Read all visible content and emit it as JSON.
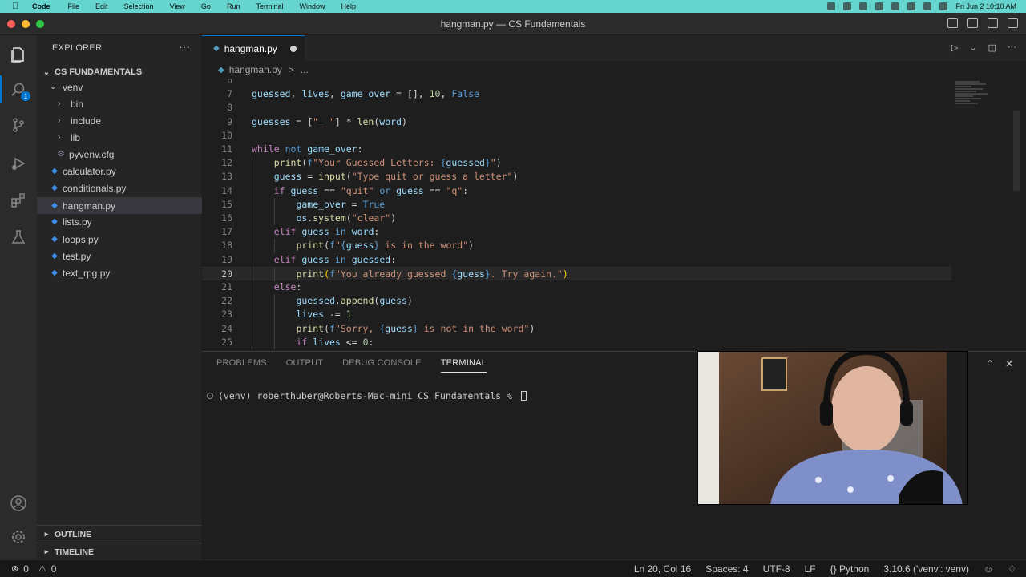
{
  "menubar": {
    "app": "Code",
    "items": [
      "File",
      "Edit",
      "Selection",
      "View",
      "Go",
      "Run",
      "Terminal",
      "Window",
      "Help"
    ],
    "datetime": "Fri Jun 2  10:10 AM"
  },
  "window": {
    "title": "hangman.py — CS Fundamentals"
  },
  "activity": {
    "explorer_badge": "1"
  },
  "sidebar": {
    "header": "EXPLORER",
    "more": "···",
    "folder": "CS FUNDAMENTALS",
    "items": [
      {
        "label": "venv",
        "type": "folder-open",
        "depth": 1
      },
      {
        "label": "bin",
        "type": "folder",
        "depth": 2
      },
      {
        "label": "include",
        "type": "folder",
        "depth": 2
      },
      {
        "label": "lib",
        "type": "folder",
        "depth": 2
      },
      {
        "label": "pyvenv.cfg",
        "type": "config",
        "depth": 2
      },
      {
        "label": "calculator.py",
        "type": "py",
        "depth": 1
      },
      {
        "label": "conditionals.py",
        "type": "py",
        "depth": 1
      },
      {
        "label": "hangman.py",
        "type": "py",
        "depth": 1,
        "selected": true
      },
      {
        "label": "lists.py",
        "type": "py",
        "depth": 1
      },
      {
        "label": "loops.py",
        "type": "py",
        "depth": 1
      },
      {
        "label": "test.py",
        "type": "py",
        "depth": 1
      },
      {
        "label": "text_rpg.py",
        "type": "py",
        "depth": 1
      }
    ],
    "outline": "OUTLINE",
    "timeline": "TIMELINE"
  },
  "editor": {
    "tab_label": "hangman.py",
    "breadcrumb_file": "hangman.py",
    "breadcrumb_more": "...",
    "current_line": 20,
    "lines": [
      {
        "num": "6",
        "indent": 0,
        "html": ""
      },
      {
        "num": "7",
        "indent": 0,
        "html": "<span class='va'>guessed</span>, <span class='va'>lives</span>, <span class='va'>game_over</span> = [], <span class='nu'>10</span>, <span class='bi'>False</span>"
      },
      {
        "num": "8",
        "indent": 0,
        "html": ""
      },
      {
        "num": "9",
        "indent": 0,
        "html": "<span class='va'>guesses</span> = [<span class='st'>\"_ \"</span>] * <span class='fn'>len</span>(<span class='va'>word</span>)"
      },
      {
        "num": "10",
        "indent": 0,
        "html": ""
      },
      {
        "num": "11",
        "indent": 0,
        "html": "<span class='kw'>while</span> <span class='bi'>not</span> <span class='va'>game_over</span>:"
      },
      {
        "num": "12",
        "indent": 1,
        "html": "<span class='fn'>print</span>(<span class='bi'>f</span><span class='st'>\"Your Guessed Letters: </span><span class='bi'>{</span><span class='va'>guessed</span><span class='bi'>}</span><span class='st'>\"</span>)"
      },
      {
        "num": "13",
        "indent": 1,
        "html": "<span class='va'>guess</span> = <span class='fn'>input</span>(<span class='st'>\"Type quit or guess a letter\"</span>)"
      },
      {
        "num": "14",
        "indent": 1,
        "html": "<span class='kw'>if</span> <span class='va'>guess</span> == <span class='st'>\"quit\"</span> <span class='bi'>or</span> <span class='va'>guess</span> == <span class='st'>\"q\"</span>:"
      },
      {
        "num": "15",
        "indent": 2,
        "html": "<span class='va'>game_over</span> = <span class='bi'>True</span>"
      },
      {
        "num": "16",
        "indent": 2,
        "html": "<span class='va'>os</span>.<span class='fn'>system</span>(<span class='st'>\"clear\"</span>)"
      },
      {
        "num": "17",
        "indent": 1,
        "html": "<span class='kw'>elif</span> <span class='va'>guess</span> <span class='bi'>in</span> <span class='va'>word</span>:"
      },
      {
        "num": "18",
        "indent": 2,
        "html": "<span class='fn'>print</span>(<span class='bi'>f</span><span class='st'>\"</span><span class='bi'>{</span><span class='va'>guess</span><span class='bi'>}</span><span class='st'> is in the word\"</span>)"
      },
      {
        "num": "19",
        "indent": 1,
        "html": "<span class='kw'>elif</span> <span class='va'>guess</span> <span class='bi'>in</span> <span class='va'>guessed</span>:"
      },
      {
        "num": "20",
        "indent": 2,
        "html": "<span class='fn'>print</span><span class='br'>(</span><span class='bi'>f</span><span class='st'>\"You already guessed </span><span class='bi'>{</span><span class='va'>guess</span><span class='bi'>}</span><span class='st'>. Try again.\"</span><span class='br'>)</span>"
      },
      {
        "num": "21",
        "indent": 1,
        "html": "<span class='kw'>else</span>:"
      },
      {
        "num": "22",
        "indent": 2,
        "html": "<span class='va'>guessed</span>.<span class='fn'>append</span>(<span class='va'>guess</span>)"
      },
      {
        "num": "23",
        "indent": 2,
        "html": "<span class='va'>lives</span> -= <span class='nu'>1</span>"
      },
      {
        "num": "24",
        "indent": 2,
        "html": "<span class='fn'>print</span>(<span class='bi'>f</span><span class='st'>\"Sorry, </span><span class='bi'>{</span><span class='va'>guess</span><span class='bi'>}</span><span class='st'> is not in the word\"</span>)"
      },
      {
        "num": "25",
        "indent": 2,
        "html": "<span class='kw'>if</span> <span class='va'>lives</span> <= <span class='nu'>0</span>:"
      }
    ]
  },
  "panel": {
    "tabs": [
      "PROBLEMS",
      "OUTPUT",
      "DEBUG CONSOLE",
      "TERMINAL"
    ],
    "active_tab": "TERMINAL",
    "terminal_line": "(venv) roberthuber@Roberts-Mac-mini CS Fundamentals % "
  },
  "status": {
    "errors": "0",
    "warnings": "0",
    "position": "Ln 20, Col 16",
    "spaces": "Spaces: 4",
    "encoding": "UTF-8",
    "eol": "LF",
    "language": "Python",
    "interpreter": "3.10.6 ('venv': venv)"
  },
  "colors": {
    "menubar": "#66d4cf",
    "accent": "#0078d4",
    "editor_bg": "#1e1e1e",
    "sidebar_bg": "#252526"
  }
}
